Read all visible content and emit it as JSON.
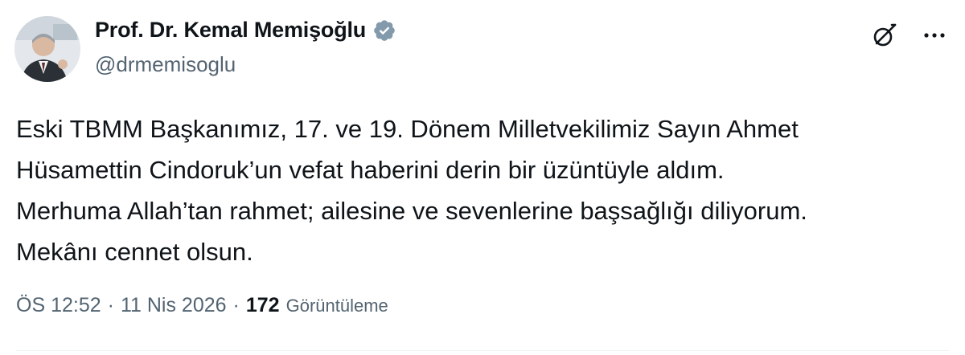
{
  "author": {
    "display_name": "Prof. Dr. Kemal Memişoğlu",
    "handle": "@drmemisoglu",
    "verified": true,
    "verified_color": "#829aab"
  },
  "actions": {
    "grok_icon": "grok-icon",
    "more_icon": "more-icon"
  },
  "tweet": {
    "lines": [
      "Eski TBMM Başkanımız, 17. ve 19. Dönem Milletvekilimiz Sayın Ahmet",
      "Hüsamettin Cindoruk’un vefat haberini derin bir üzüntüyle aldım.",
      "Merhuma Allah’tan rahmet; ailesine ve sevenlerine başsağlığı diliyorum.",
      "Mekânı cennet olsun."
    ]
  },
  "meta": {
    "time": "ÖS 12:52",
    "separator": "·",
    "date": "11 Nis 2026",
    "views_count": "172",
    "views_label": "Görüntüleme"
  },
  "colors": {
    "text": "#0f1419",
    "secondary": "#536471",
    "divider": "#eff3f4"
  }
}
